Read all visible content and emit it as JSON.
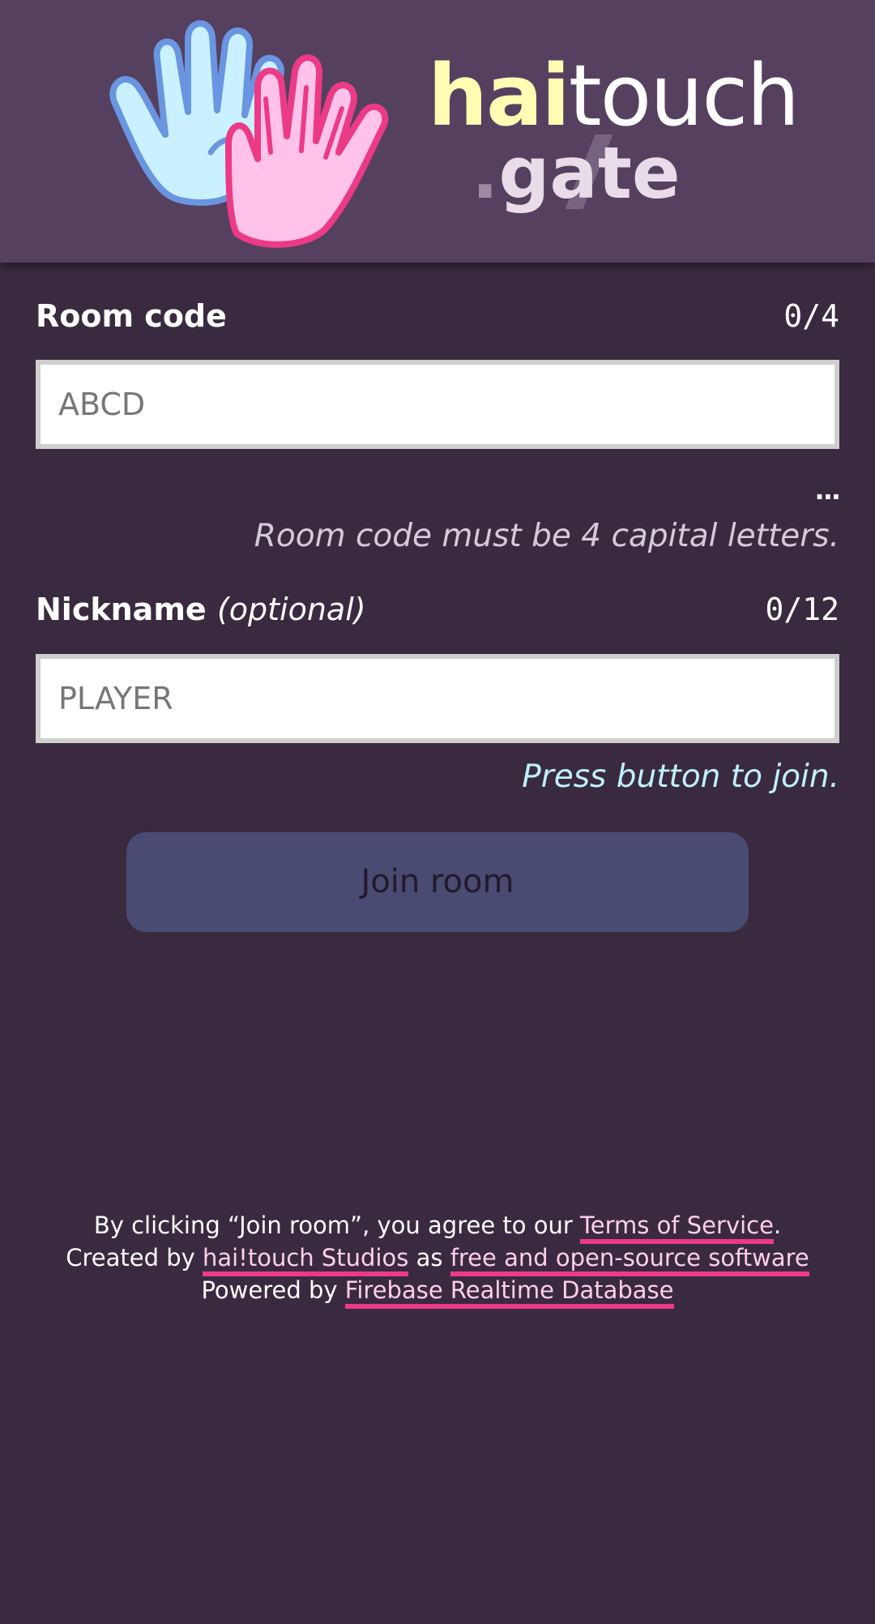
{
  "header": {
    "logo_hai": "hai",
    "logo_touch": "touch",
    "logo_sub_dot": ".",
    "logo_sub": "gate"
  },
  "room_code": {
    "label": "Room code",
    "counter": "0/4",
    "placeholder": "ABCD",
    "value": "",
    "ellipsis": "...",
    "hint": "Room code must be 4 capital letters."
  },
  "nickname": {
    "label": "Nickname",
    "label_optional": "(optional)",
    "counter": "0/12",
    "placeholder": "PLAYER",
    "value": "",
    "hint": "Press button to join."
  },
  "join_button": {
    "label": "Join room"
  },
  "footer": {
    "line1_prefix": "By clicking “Join room”, you agree to our ",
    "terms_link": "Terms of Service",
    "line1_suffix": ".",
    "line2_prefix": "Created by ",
    "studio_link": "hai!touch Studios",
    "line2_mid": " as ",
    "foss_link": "free and open-source software",
    "line3_prefix": "Powered by ",
    "firebase_link": "Firebase Realtime Database"
  },
  "colors": {
    "header_bg": "#56405f",
    "page_bg": "#3a2a3f",
    "logo_yellow": "#fffcb3",
    "hand_blue": "#c9f1ff",
    "hand_blue_outline": "#6a95e0",
    "hand_pink": "#ffc2ea",
    "hand_pink_outline": "#ec3b86",
    "link_underline": "#ec3b86",
    "button_bg": "#4a4b73",
    "hint_ok": "#bff0ff"
  },
  "icons": {
    "left_hand": "blue-hand-icon",
    "right_hand": "pink-hand-icon"
  }
}
